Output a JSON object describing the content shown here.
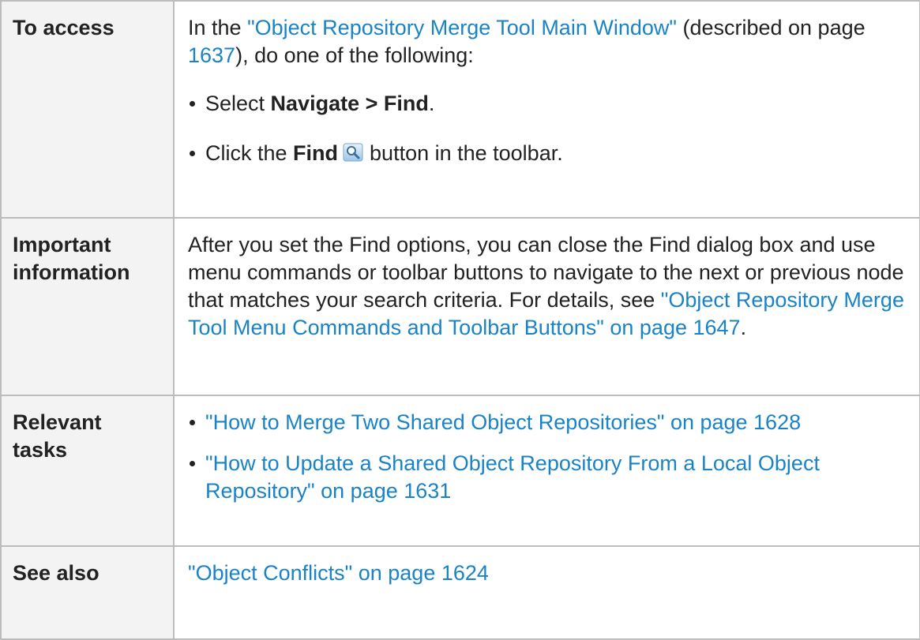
{
  "rows": {
    "access": {
      "label": "To access",
      "intro_prefix": "In the ",
      "intro_link": "\"Object Repository Merge Tool Main Window\"",
      "intro_mid": " (described on page ",
      "intro_page": "1637",
      "intro_suffix": "), do one of the following:",
      "bullets": [
        {
          "prefix": "Select ",
          "bold": "Navigate > Find",
          "suffix": "."
        },
        {
          "prefix": "Click the ",
          "bold": "Find",
          "icon": "magnifier-icon",
          "suffix": "button in the toolbar."
        }
      ]
    },
    "info": {
      "label_line1": "Important",
      "label_line2": "information",
      "text": "After you set the Find options, you can close the Find dialog box and use menu commands or toolbar buttons to navigate to the next or previous node that matches your search criteria. For details, see ",
      "link": "\"Object Repository Merge Tool Menu Commands and Toolbar Buttons\" on page 1647",
      "suffix": "."
    },
    "tasks": {
      "label_line1": "Relevant",
      "label_line2": "tasks",
      "links": [
        "\"How to Merge Two Shared Object Repositories\" on page 1628",
        "\"How to Update a Shared Object Repository From a Local Object Repository\" on page 1631"
      ]
    },
    "see_also": {
      "label": "See also",
      "link": "\"Object Conflicts\" on page 1624"
    }
  },
  "colors": {
    "link": "#1a83c6",
    "border": "#bdbdbd",
    "label_bg": "#f3f3f3",
    "text": "#222222"
  }
}
